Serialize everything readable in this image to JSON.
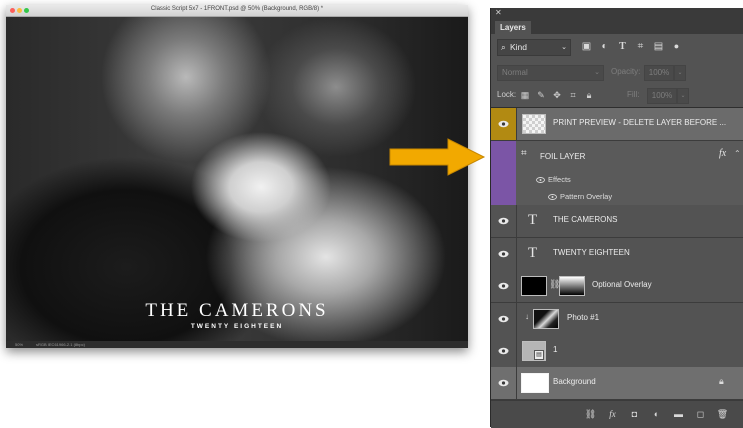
{
  "document": {
    "title": "Classic Script 5x7 - 1FRONT.psd @ 50% (Background, RGB/8) *",
    "photo_title": "THE CAMERONS",
    "photo_subtitle": "TWENTY EIGHTEEN",
    "zoom": "50%",
    "doc_info": "sRGB IEC61966-2.1 (8bpc)"
  },
  "panel": {
    "tab": "Layers",
    "kind_label": "Kind",
    "blend_mode": "Normal",
    "opacity_label": "Opacity:",
    "opacity_value": "100%",
    "lock_label": "Lock:",
    "fill_label": "Fill:",
    "fill_value": "100%"
  },
  "layers": [
    {
      "name": "PRINT PREVIEW - DELETE LAYER BEFORE ...",
      "visible": true,
      "kind": "pixel",
      "selected": false
    },
    {
      "name": "FOIL LAYER",
      "visible": false,
      "kind": "artboard",
      "fx": "fx",
      "effects_label": "Effects",
      "effects": [
        "Pattern Overlay"
      ]
    },
    {
      "name": "THE CAMERONS",
      "visible": true,
      "kind": "type"
    },
    {
      "name": "TWENTY EIGHTEEN",
      "visible": true,
      "kind": "type"
    },
    {
      "name": "Optional Overlay",
      "visible": true,
      "kind": "masked-pixel"
    },
    {
      "name": "Photo #1",
      "visible": true,
      "kind": "clipped-pixel"
    },
    {
      "name": "1",
      "visible": true,
      "kind": "smart-object"
    },
    {
      "name": "Background",
      "visible": true,
      "kind": "background",
      "locked": true
    }
  ],
  "icons": {
    "eye": "eye-icon",
    "type": "type-layer-icon",
    "lock": "lock-icon",
    "link": "link-icon",
    "arrow": "arrow-right-icon"
  },
  "colors": {
    "arrow": "#f2a900",
    "print_preview_highlight": "#b28a12",
    "foil_highlight": "#7b55a6",
    "panel_bg": "#535353"
  }
}
